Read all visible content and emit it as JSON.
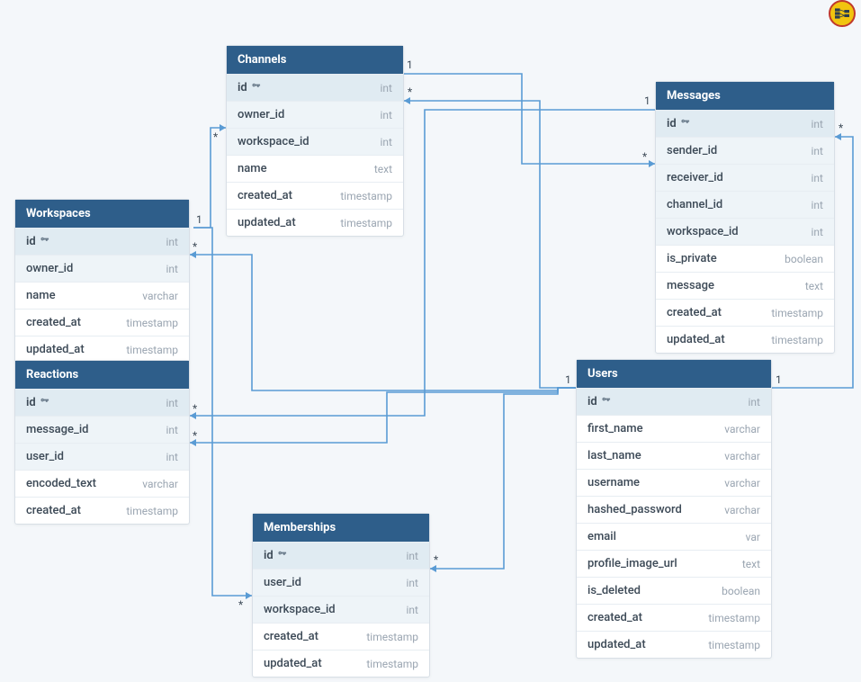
{
  "tables": {
    "workspaces": {
      "title": "Workspaces",
      "columns": [
        {
          "name": "id",
          "type": "int",
          "pk": true
        },
        {
          "name": "owner_id",
          "type": "int",
          "fk": true
        },
        {
          "name": "name",
          "type": "varchar"
        },
        {
          "name": "created_at",
          "type": "timestamp"
        },
        {
          "name": "updated_at",
          "type": "timestamp"
        }
      ]
    },
    "reactions": {
      "title": "Reactions",
      "columns": [
        {
          "name": "id",
          "type": "int",
          "pk": true
        },
        {
          "name": "message_id",
          "type": "int",
          "fk": true
        },
        {
          "name": "user_id",
          "type": "int",
          "fk": true
        },
        {
          "name": "encoded_text",
          "type": "varchar"
        },
        {
          "name": "created_at",
          "type": "timestamp"
        }
      ]
    },
    "channels": {
      "title": "Channels",
      "columns": [
        {
          "name": "id",
          "type": "int",
          "pk": true
        },
        {
          "name": "owner_id",
          "type": "int",
          "fk": true
        },
        {
          "name": "workspace_id",
          "type": "int",
          "fk": true
        },
        {
          "name": "name",
          "type": "text"
        },
        {
          "name": "created_at",
          "type": "timestamp"
        },
        {
          "name": "updated_at",
          "type": "timestamp"
        }
      ]
    },
    "memberships": {
      "title": "Memberships",
      "columns": [
        {
          "name": "id",
          "type": "int",
          "pk": true
        },
        {
          "name": "user_id",
          "type": "int",
          "fk": true
        },
        {
          "name": "workspace_id",
          "type": "int",
          "fk": true
        },
        {
          "name": "created_at",
          "type": "timestamp"
        },
        {
          "name": "updated_at",
          "type": "timestamp"
        }
      ]
    },
    "messages": {
      "title": "Messages",
      "columns": [
        {
          "name": "id",
          "type": "int",
          "pk": true
        },
        {
          "name": "sender_id",
          "type": "int",
          "fk": true
        },
        {
          "name": "receiver_id",
          "type": "int",
          "fk": true
        },
        {
          "name": "channel_id",
          "type": "int",
          "fk": true
        },
        {
          "name": "workspace_id",
          "type": "int",
          "fk": true
        },
        {
          "name": "is_private",
          "type": "boolean"
        },
        {
          "name": "message",
          "type": "text"
        },
        {
          "name": "created_at",
          "type": "timestamp"
        },
        {
          "name": "updated_at",
          "type": "timestamp"
        }
      ]
    },
    "users": {
      "title": "Users",
      "columns": [
        {
          "name": "id",
          "type": "int",
          "pk": true
        },
        {
          "name": "first_name",
          "type": "varchar"
        },
        {
          "name": "last_name",
          "type": "varchar"
        },
        {
          "name": "username",
          "type": "varchar"
        },
        {
          "name": "hashed_password",
          "type": "varchar"
        },
        {
          "name": "email",
          "type": "var"
        },
        {
          "name": "profile_image_url",
          "type": "text"
        },
        {
          "name": "is_deleted",
          "type": "boolean"
        },
        {
          "name": "created_at",
          "type": "timestamp"
        },
        {
          "name": "updated_at",
          "type": "timestamp"
        }
      ]
    }
  },
  "relationships": [
    {
      "from_table": "Workspaces",
      "from_col": "owner_id",
      "to_table": "Users",
      "to_col": "id",
      "from_card": "*",
      "to_card": "1"
    },
    {
      "from_table": "Reactions",
      "from_col": "message_id",
      "to_table": "Messages",
      "to_col": "id",
      "from_card": "*",
      "to_card": "1"
    },
    {
      "from_table": "Reactions",
      "from_col": "user_id",
      "to_table": "Users",
      "to_col": "id",
      "from_card": "*",
      "to_card": "1"
    },
    {
      "from_table": "Channels",
      "from_col": "owner_id",
      "to_table": "Users",
      "to_col": "id",
      "from_card": "*",
      "to_card": "1"
    },
    {
      "from_table": "Channels",
      "from_col": "workspace_id",
      "to_table": "Workspaces",
      "to_col": "id",
      "from_card": "*",
      "to_card": "1"
    },
    {
      "from_table": "Memberships",
      "from_col": "user_id",
      "to_table": "Users",
      "to_col": "id",
      "from_card": "*",
      "to_card": "1"
    },
    {
      "from_table": "Memberships",
      "from_col": "workspace_id",
      "to_table": "Workspaces",
      "to_col": "id",
      "from_card": "*",
      "to_card": "1"
    },
    {
      "from_table": "Messages",
      "from_col": "sender_id",
      "to_table": "Users",
      "to_col": "id",
      "from_card": "*",
      "to_card": "1"
    },
    {
      "from_table": "Messages",
      "from_col": "receiver_id",
      "to_table": "Channels",
      "to_col": "id",
      "from_card": "*",
      "to_card": "1"
    }
  ]
}
